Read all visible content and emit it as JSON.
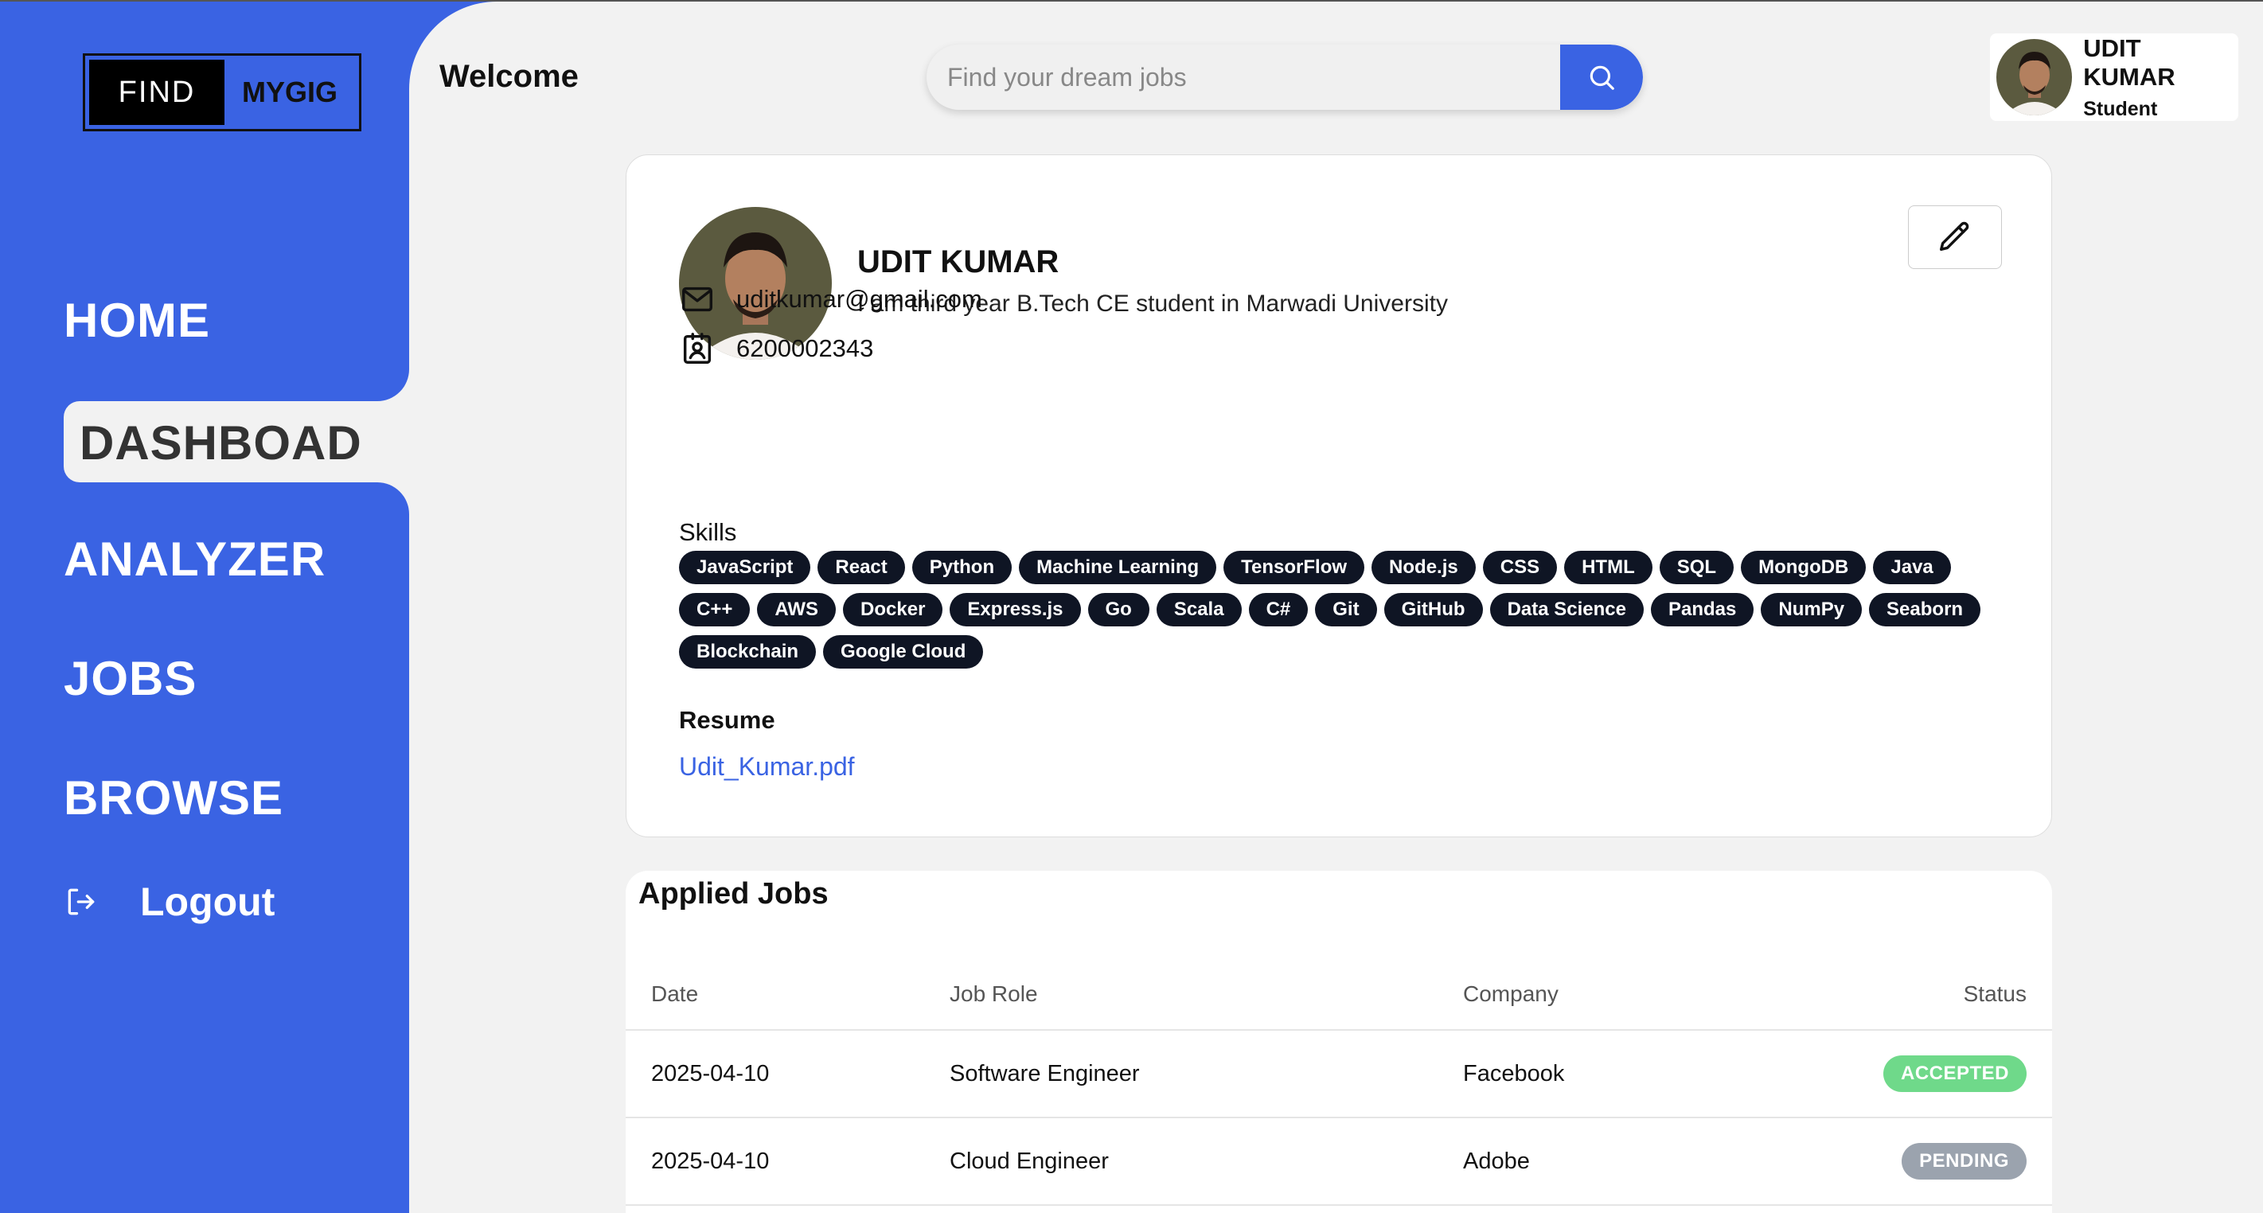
{
  "logo": {
    "part1": "FIND",
    "part2": "MYGIG"
  },
  "nav": {
    "home": "HOME",
    "dashboard": "DASHBOAD",
    "analyzer": "ANALYZER",
    "jobs": "JOBS",
    "browse": "BROWSE",
    "logout": "Logout"
  },
  "header": {
    "welcome": "Welcome",
    "search_placeholder": "Find your dream jobs",
    "user_name": "UDIT KUMAR",
    "user_role": "Student"
  },
  "profile": {
    "name": "UDIT KUMAR",
    "bio": "I am third year B.Tech CE student in Marwadi University",
    "email": "uditkumar@gmail.com",
    "phone": "6200002343",
    "skills_title": "Skills",
    "skills": [
      "JavaScript",
      "React",
      "Python",
      "Machine Learning",
      "TensorFlow",
      "Node.js",
      "CSS",
      "HTML",
      "SQL",
      "MongoDB",
      "Java",
      "C++",
      "AWS",
      "Docker",
      "Express.js",
      "Go",
      "Scala",
      "C#",
      "Git",
      "GitHub",
      "Data Science",
      "Pandas",
      "NumPy",
      "Seaborn",
      "Blockchain",
      "Google Cloud"
    ],
    "resume_title": "Resume",
    "resume_file": "Udit_Kumar.pdf"
  },
  "applied_jobs": {
    "title": "Applied Jobs",
    "headers": {
      "date": "Date",
      "role": "Job Role",
      "company": "Company",
      "status": "Status"
    },
    "rows": [
      {
        "date": "2025-04-10",
        "role": "Software Engineer",
        "company": "Facebook",
        "status": "ACCEPTED",
        "status_color": "#6fd98a"
      },
      {
        "date": "2025-04-10",
        "role": "Cloud Engineer",
        "company": "Adobe",
        "status": "PENDING",
        "status_color": "#9ba3ae"
      }
    ]
  },
  "colors": {
    "accent": "#3a63e3",
    "skill_bg": "#0f1524",
    "background": "#f2f2f2"
  }
}
